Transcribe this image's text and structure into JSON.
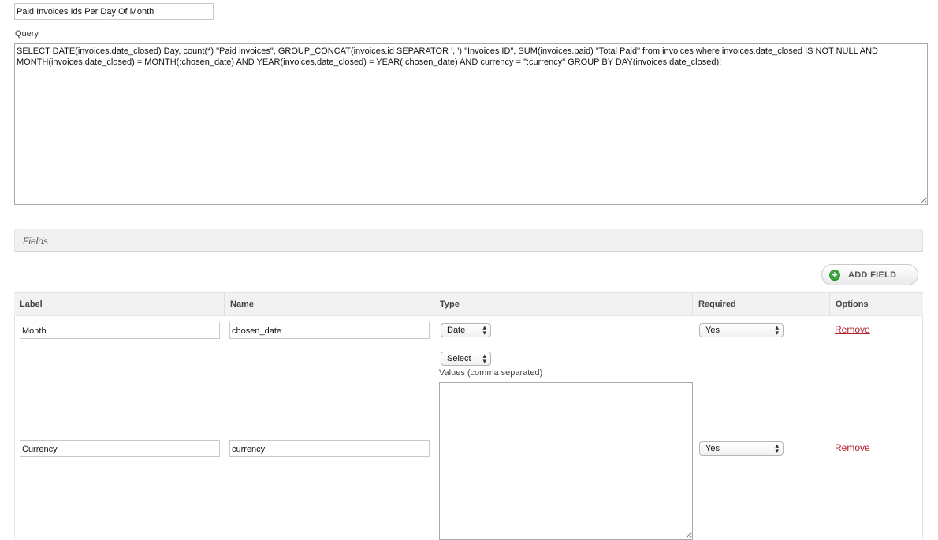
{
  "report": {
    "title_value": "Paid Invoices Ids Per Day Of Month",
    "query_label": "Query",
    "query_value": "SELECT DATE(invoices.date_closed) Day, count(*) \"Paid invoices\", GROUP_CONCAT(invoices.id SEPARATOR ', ') \"Invoices ID\", SUM(invoices.paid) \"Total Paid\" from invoices where invoices.date_closed IS NOT NULL AND MONTH(invoices.date_closed) = MONTH(:chosen_date) AND YEAR(invoices.date_closed) = YEAR(:chosen_date) AND currency = \":currency\" GROUP BY DAY(invoices.date_closed);"
  },
  "fields": {
    "section_title": "Fields",
    "add_button_label": "ADD FIELD",
    "add_icon": "plus-circle-icon",
    "columns": [
      "Label",
      "Name",
      "Type",
      "Required",
      "Options"
    ],
    "values_label": "Values (comma separated)",
    "rows": [
      {
        "label": "Month",
        "name": "chosen_date",
        "type": "Date",
        "required": "Yes",
        "option": "Remove"
      },
      {
        "label": "Currency",
        "name": "currency",
        "type": "Select",
        "required": "Yes",
        "option": "Remove"
      }
    ]
  },
  "colors": {
    "remove_link": "#b0202a",
    "add_icon_green": "#3ca23c",
    "header_bg": "#f2f2f2"
  }
}
